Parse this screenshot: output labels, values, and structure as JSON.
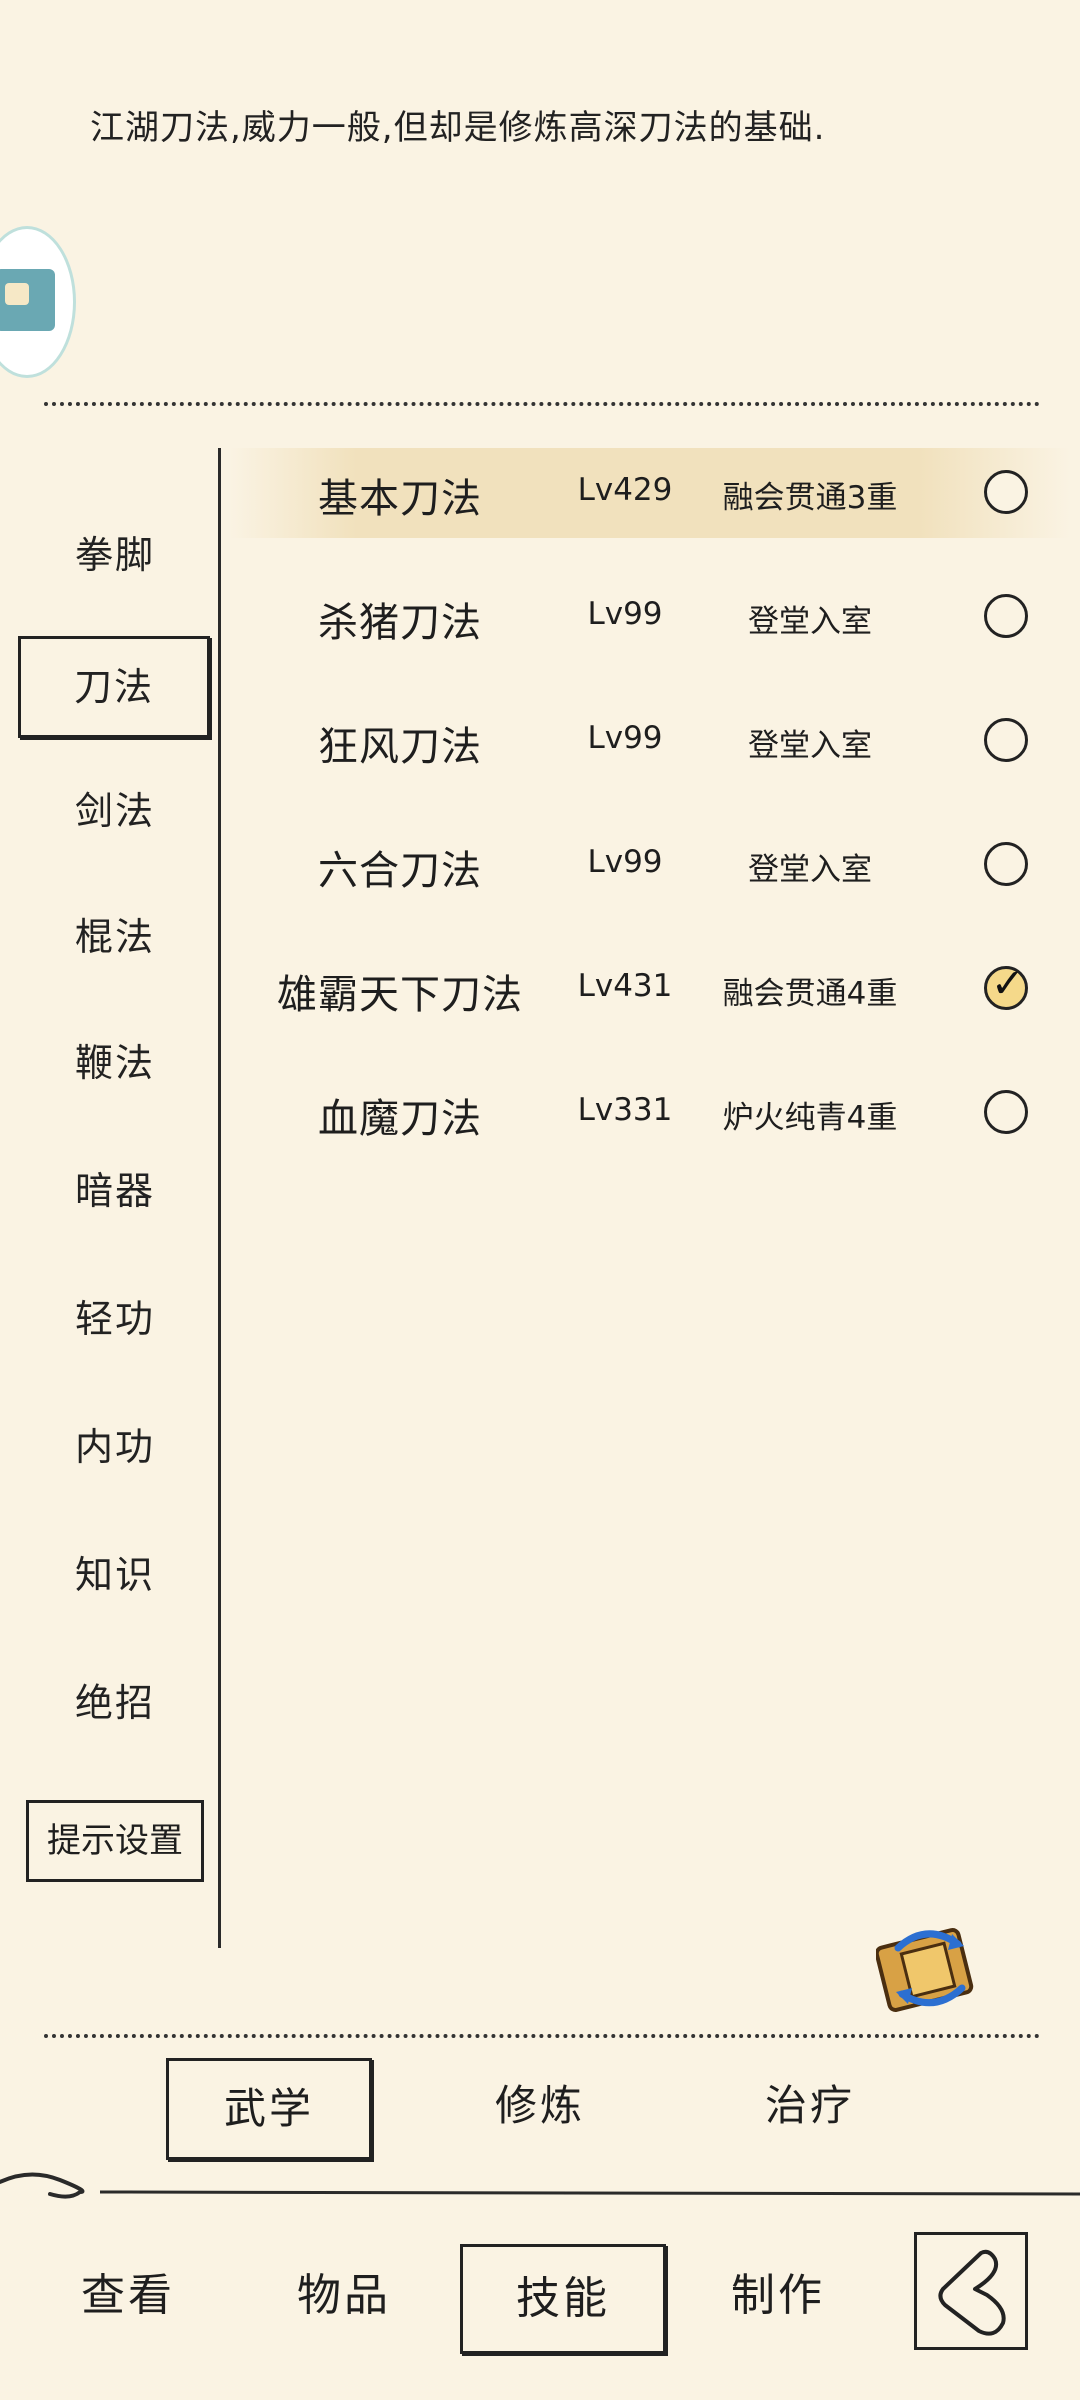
{
  "description": "江湖刀法,威力一般,但却是修炼高深刀法的基础.",
  "categories": [
    "拳脚",
    "刀法",
    "剑法",
    "棍法",
    "鞭法",
    "暗器",
    "轻功",
    "内功",
    "知识",
    "绝招"
  ],
  "active_category": "刀法",
  "hint_button": "提示设置",
  "skills": [
    {
      "name": "基本刀法",
      "level": "Lv429",
      "status": "融会贯通3重",
      "checked": false
    },
    {
      "name": "杀猪刀法",
      "level": "Lv99",
      "status": "登堂入室",
      "checked": false
    },
    {
      "name": "狂风刀法",
      "level": "Lv99",
      "status": "登堂入室",
      "checked": false
    },
    {
      "name": "六合刀法",
      "level": "Lv99",
      "status": "登堂入室",
      "checked": false
    },
    {
      "name": "雄霸天下刀法",
      "level": "Lv431",
      "status": "融会贯通4重",
      "checked": true
    },
    {
      "name": "血魔刀法",
      "level": "Lv331",
      "status": "炉火纯青4重",
      "checked": false
    }
  ],
  "sub_tabs": [
    "武学",
    "修炼",
    "治疗"
  ],
  "active_sub_tab": "武学",
  "nav_tabs": [
    "查看",
    "物品",
    "技能",
    "制作"
  ],
  "active_nav_tab": "技能",
  "icons": {
    "avatar": "house-avatar-icon",
    "scroll": "scroll-swap-icon",
    "back": "back-arrow-icon",
    "check": "check-icon"
  },
  "colors": {
    "background": "#faf3e3",
    "highlight": "#f1e1bd",
    "ink": "#222222"
  }
}
